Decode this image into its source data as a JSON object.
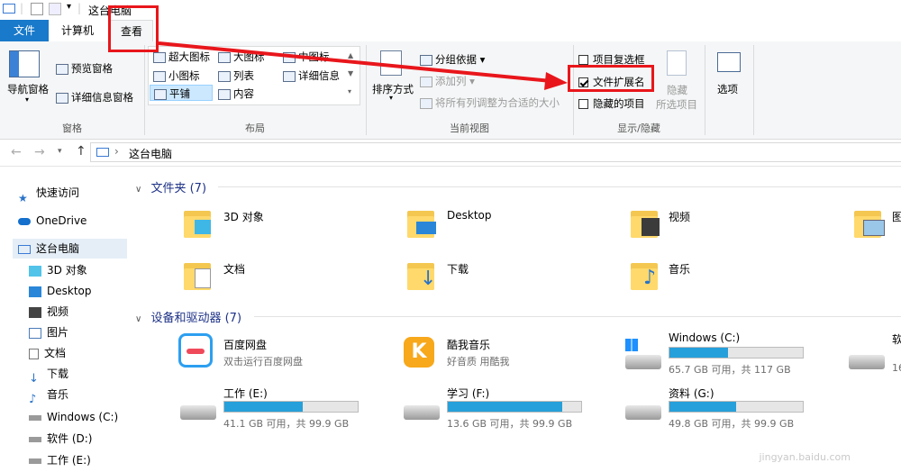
{
  "window": {
    "title": "这台电脑"
  },
  "tabs": [
    {
      "label": "文件"
    },
    {
      "label": "计算机"
    },
    {
      "label": "查看"
    }
  ],
  "ribbon": {
    "panes": {
      "nav_pane": "导航窗格",
      "preview_pane": "预览窗格",
      "details_pane": "详细信息窗格",
      "group_label": "窗格"
    },
    "layout": {
      "items": [
        "超大图标",
        "大图标",
        "中图标",
        "小图标",
        "列表",
        "详细信息",
        "平铺",
        "内容"
      ],
      "selected": "平铺",
      "group_label": "布局"
    },
    "current_view": {
      "sort_by": "排序方式",
      "group_by": "分组依据",
      "add_column": "添加列",
      "fit_columns": "将所有列调整为合适的大小",
      "group_label": "当前视图"
    },
    "show_hide": {
      "item_checkboxes": "项目复选框",
      "item_checkboxes_checked": false,
      "file_extensions": "文件扩展名",
      "file_extensions_checked": true,
      "hidden_items": "隐藏的项目",
      "hidden_items_checked": false,
      "hide_selected_line1": "隐藏",
      "hide_selected_line2": "所选项目",
      "group_label": "显示/隐藏"
    },
    "options": "选项"
  },
  "address": {
    "path": "这台电脑"
  },
  "nav": [
    {
      "label": "快速访问"
    },
    {
      "label": "OneDrive"
    },
    {
      "label": "这台电脑"
    },
    {
      "label": "3D 对象"
    },
    {
      "label": "Desktop"
    },
    {
      "label": "视频"
    },
    {
      "label": "图片"
    },
    {
      "label": "文档"
    },
    {
      "label": "下载"
    },
    {
      "label": "音乐"
    },
    {
      "label": "Windows (C:)"
    },
    {
      "label": "软件 (D:)"
    },
    {
      "label": "工作 (E:)"
    }
  ],
  "folders": {
    "heading": "文件夹 (7)",
    "items": [
      {
        "name": "3D 对象"
      },
      {
        "name": "Desktop"
      },
      {
        "name": "视频"
      },
      {
        "name": "图"
      },
      {
        "name": "文档"
      },
      {
        "name": "下载"
      },
      {
        "name": "音乐"
      }
    ]
  },
  "devices": {
    "heading": "设备和驱动器 (7)",
    "items": [
      {
        "name": "百度网盘",
        "sub": "双击运行百度网盘"
      },
      {
        "name": "酷我音乐",
        "sub": "好音质 用酷我"
      },
      {
        "name": "Windows (C:)",
        "sub": "65.7 GB 可用，共 117 GB",
        "used_fraction": 0.44
      },
      {
        "name": "软",
        "sub": "16"
      },
      {
        "name": "工作 (E:)",
        "sub": "41.1 GB 可用，共 99.9 GB",
        "used_fraction": 0.59
      },
      {
        "name": "学习 (F:)",
        "sub": "13.6 GB 可用，共 99.9 GB",
        "used_fraction": 0.86
      },
      {
        "name": "资料 (G:)",
        "sub": "49.8 GB 可用，共 99.9 GB",
        "used_fraction": 0.5
      }
    ]
  },
  "watermark": "jingyan.baidu.com",
  "colors": {
    "accent": "#1979ca",
    "annotation": "#e8161b",
    "bar_fill": "#26a0da"
  }
}
